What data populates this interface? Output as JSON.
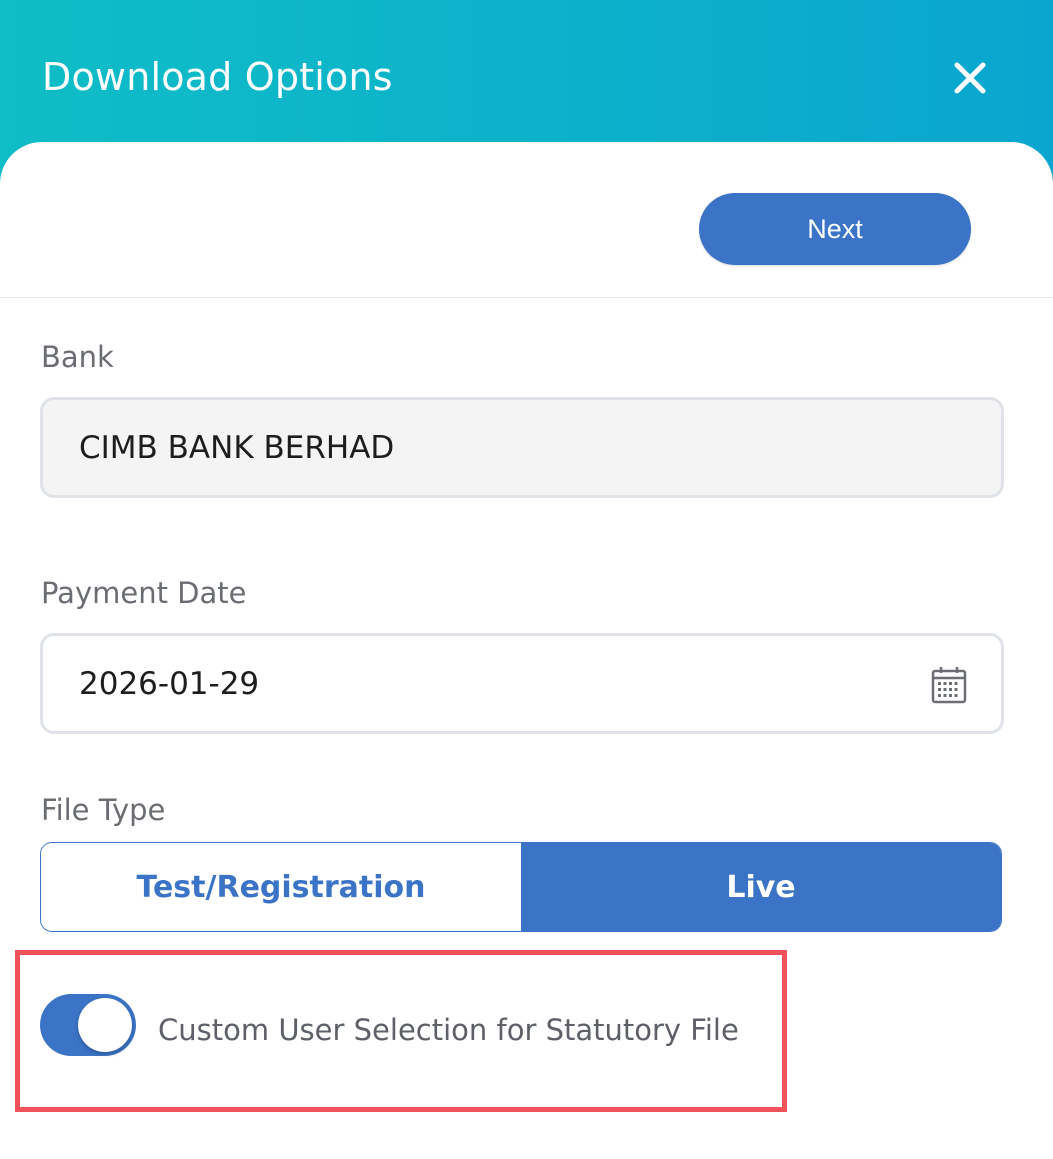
{
  "dialog": {
    "title": "Download Options",
    "close_icon": "close-icon",
    "header_gradient": [
      "#0fbdc6",
      "#0aa6cf"
    ]
  },
  "toolbar": {
    "next_label": "Next"
  },
  "form": {
    "bank": {
      "label": "Bank",
      "value": "CIMB BANK BERHAD"
    },
    "payment_date": {
      "label": "Payment Date",
      "value": "2026-01-29",
      "icon": "calendar-icon"
    },
    "file_type": {
      "label": "File Type",
      "options": [
        "Test/Registration",
        "Live"
      ],
      "selected": "Live"
    },
    "custom_user_selection": {
      "label": "Custom User Selection for Statutory File",
      "enabled": true
    }
  },
  "colors": {
    "primary": "#3b74c6",
    "highlight_box": "#f0515a"
  }
}
